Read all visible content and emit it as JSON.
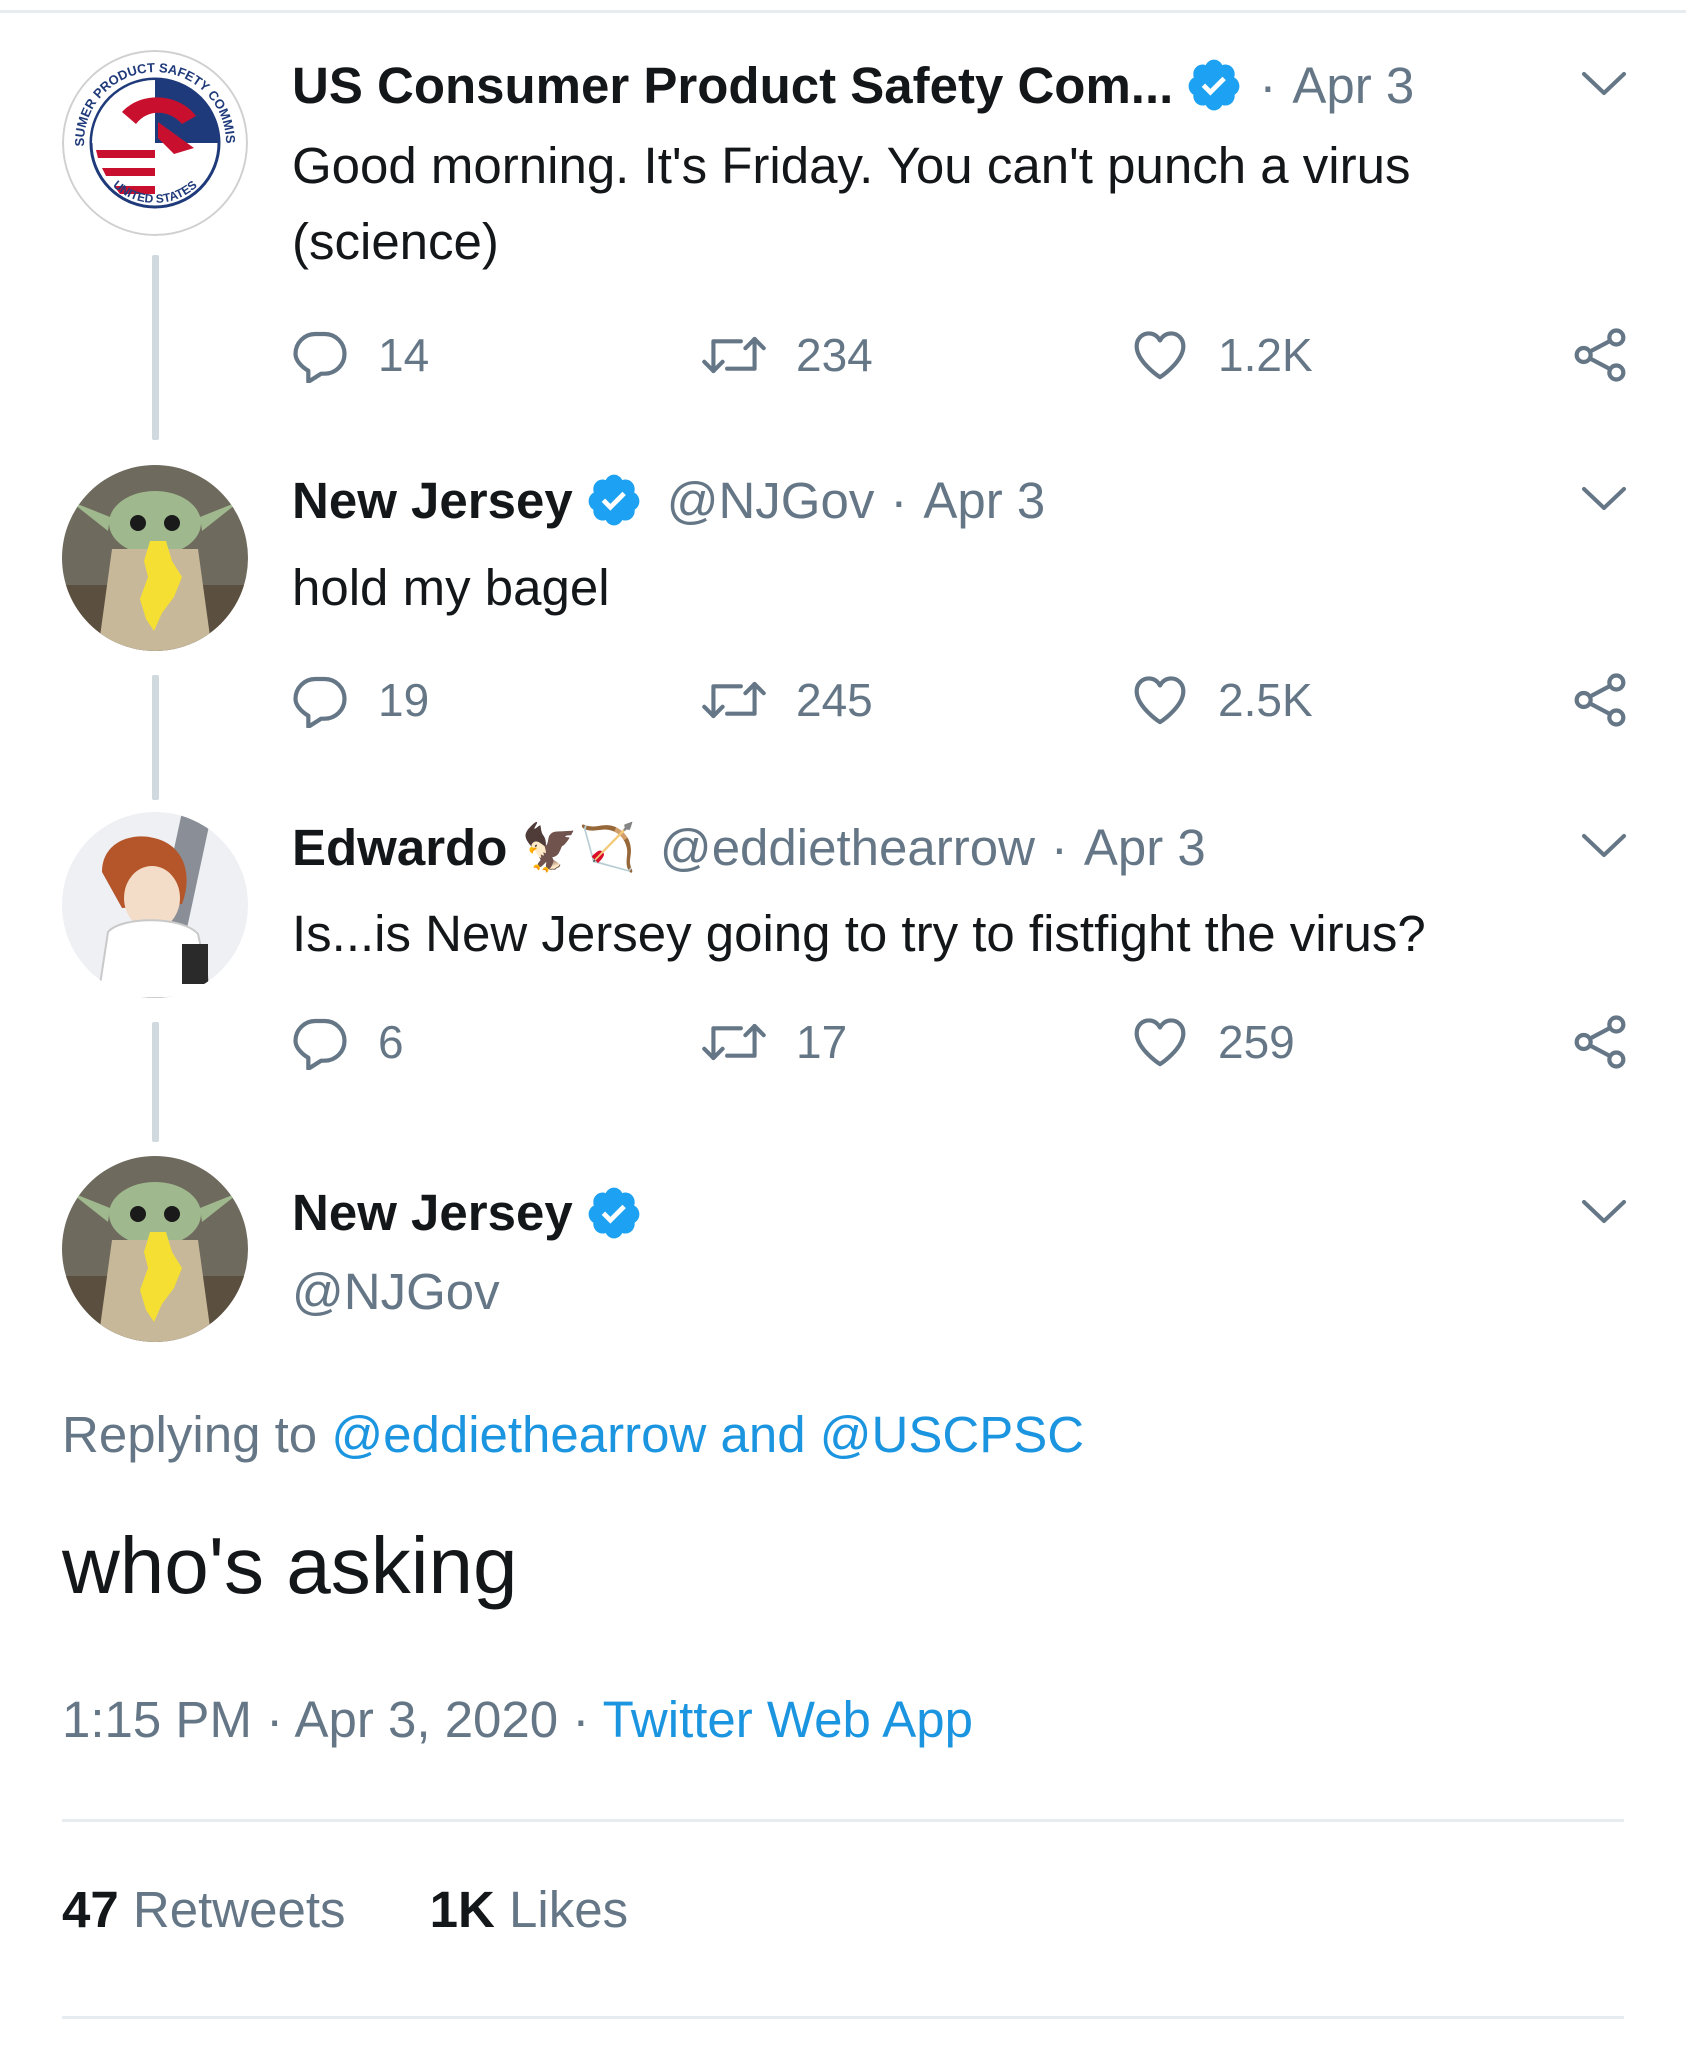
{
  "tweets": [
    {
      "name": "US Consumer Product Safety Com...",
      "date": "Apr 3",
      "text_lines": [
        "Good morning. It's Friday. You can't punch a virus",
        "(science)"
      ],
      "replies": "14",
      "retweets": "234",
      "likes": "1.2K",
      "avatar_text": {
        "top": "CONSUMER PRODUCT SAFETY COMMISSION",
        "bottom": "UNITED STATES"
      }
    },
    {
      "name": "New Jersey",
      "handle": "@NJGov",
      "date": "Apr 3",
      "text": "hold my bagel",
      "replies": "19",
      "retweets": "245",
      "likes": "2.5K"
    },
    {
      "name": "Edwardo",
      "emoji": "🦅🏹",
      "handle": "@eddiethearrow",
      "date": "Apr 3",
      "text": "Is...is New Jersey going to try to fistfight the virus?",
      "replies": "6",
      "retweets": "17",
      "likes": "259"
    }
  ],
  "main_tweet": {
    "name": "New Jersey",
    "handle": "@NJGov",
    "replying_prefix": "Replying to",
    "replying_user1": "@eddiethearrow",
    "replying_and": "and",
    "replying_user2": "@USCPSC",
    "text": "who's asking",
    "time": "1:15 PM",
    "date": "Apr 3, 2020",
    "source": "Twitter Web App",
    "retweet_count": "47",
    "retweet_label": "Retweets",
    "like_count": "1K",
    "like_label": "Likes"
  },
  "colors": {
    "accent": "#1da1f2",
    "link": "#1b95e0",
    "muted": "#657786",
    "border": "#e6ecf0"
  },
  "icons": [
    "verified-badge-icon",
    "chevron-down-icon",
    "reply-icon",
    "retweet-icon",
    "heart-icon",
    "share-icon"
  ]
}
